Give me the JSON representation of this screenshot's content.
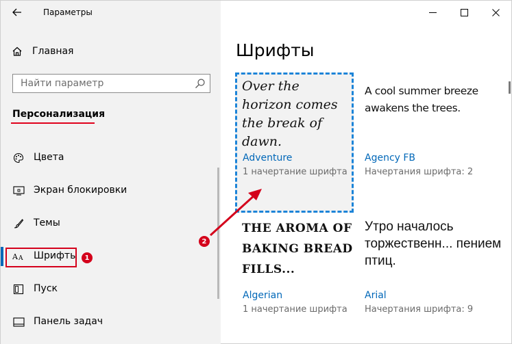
{
  "window": {
    "title": "Параметры"
  },
  "sidebar": {
    "home_label": "Главная",
    "search": {
      "placeholder": "Найти параметр"
    },
    "section_title": "Персонализация",
    "items": [
      {
        "label": "Цвета",
        "icon": "palette-icon"
      },
      {
        "label": "Экран блокировки",
        "icon": "lock-screen-icon"
      },
      {
        "label": "Темы",
        "icon": "themes-icon"
      },
      {
        "label": "Шрифты",
        "icon": "fonts-icon",
        "active": true
      },
      {
        "label": "Пуск",
        "icon": "start-icon"
      },
      {
        "label": "Панель задач",
        "icon": "taskbar-icon"
      }
    ]
  },
  "annotations": {
    "badge_1": "1",
    "badge_2": "2",
    "highlight_color": "#d4001b"
  },
  "main": {
    "title": "Шрифты",
    "fonts": [
      {
        "preview": "Over the horizon comes the break of dawn.",
        "name": "Adventure",
        "meta": "1 начертание шрифта"
      },
      {
        "preview": "A cool summer breeze awakens the trees.",
        "name": "Agency FB",
        "meta": "Начертания шрифта: 2"
      },
      {
        "preview": "The aroma of baking bread fills...",
        "name": "Algerian",
        "meta": "1 начертание шрифта"
      },
      {
        "preview": "Утро началось торжественн... пением птиц.",
        "name": "Arial",
        "meta": "Начертания шрифта: 9"
      }
    ]
  },
  "colors": {
    "accent": "#0067b8",
    "selection_border": "#1c84d8",
    "sidebar_bg": "#f2f2f2"
  }
}
